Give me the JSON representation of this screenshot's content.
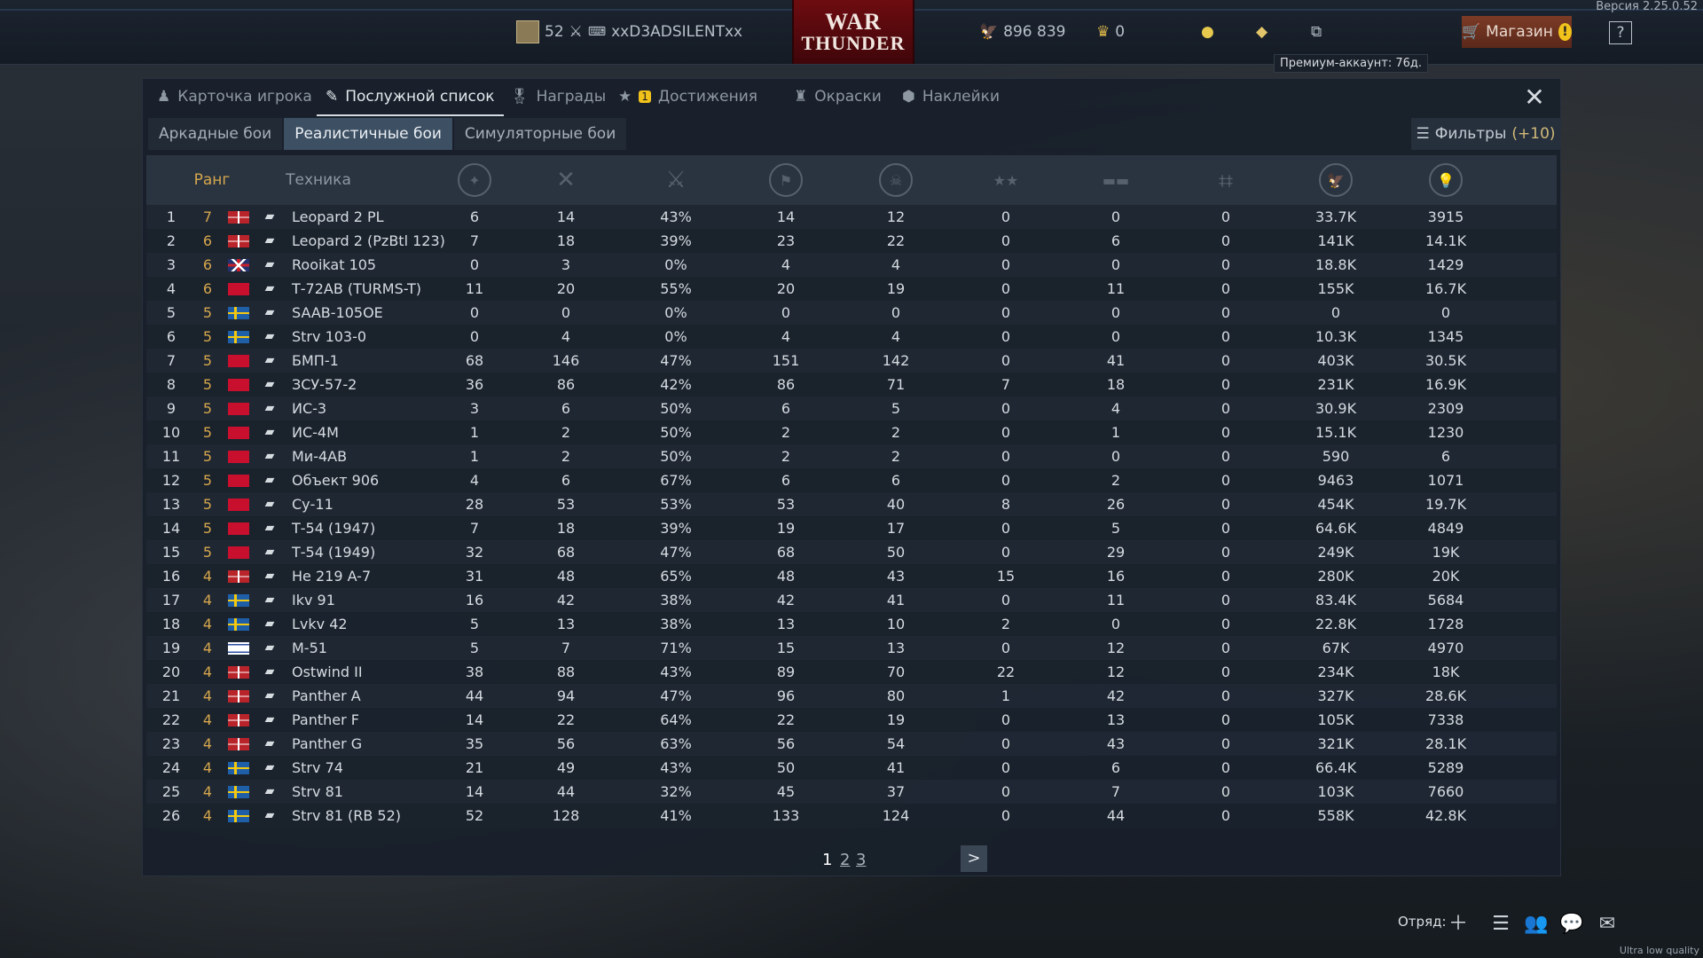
{
  "top": {
    "version": "Версия 2.25.0.52",
    "level": "52",
    "nickname": "xxD3ADSILENTxx",
    "logo_line1": "WAR",
    "logo_line2": "THUNDER",
    "silver": "896 839",
    "gold": "0",
    "shop_label": "Магазин",
    "shop_alert": "!",
    "help": "?",
    "tooltip": "Премиум-аккаунт: 76д."
  },
  "tabs": [
    {
      "label": "Карточка игрока",
      "icon": "player-card-icon"
    },
    {
      "label": "Послужной список",
      "icon": "service-record-icon"
    },
    {
      "label": "Награды",
      "icon": "medal-icon"
    },
    {
      "label": "Достижения",
      "icon": "achievements-icon",
      "badge": "1"
    },
    {
      "label": "Окраски",
      "icon": "paint-icon"
    },
    {
      "label": "Наклейки",
      "icon": "decal-icon"
    }
  ],
  "modes": [
    "Аркадные бои",
    "Реалистичные бои",
    "Симуляторные бои"
  ],
  "filters": {
    "label": "Фильтры",
    "count": "(+10)"
  },
  "table": {
    "headers": {
      "rank": "Ранг",
      "vehicle": "Техника"
    },
    "rows": [
      {
        "n": "1",
        "r": "7",
        "f": "de",
        "name": "Leopard 2 PL",
        "c": [
          "6",
          "14",
          "43%",
          "14",
          "12",
          "0",
          "0",
          "0",
          "33.7K",
          "3915"
        ]
      },
      {
        "n": "2",
        "r": "6",
        "f": "de",
        "name": "Leopard 2 (PzBtl 123)",
        "c": [
          "7",
          "18",
          "39%",
          "23",
          "22",
          "0",
          "6",
          "0",
          "141K",
          "14.1K"
        ]
      },
      {
        "n": "3",
        "r": "6",
        "f": "uk",
        "name": "Rooikat 105",
        "c": [
          "0",
          "3",
          "0%",
          "4",
          "4",
          "0",
          "0",
          "0",
          "18.8K",
          "1429"
        ]
      },
      {
        "n": "4",
        "r": "6",
        "f": "ussr",
        "name": "Т-72АВ (TURMS-T)",
        "c": [
          "11",
          "20",
          "55%",
          "20",
          "19",
          "0",
          "11",
          "0",
          "155K",
          "16.7K"
        ]
      },
      {
        "n": "5",
        "r": "5",
        "f": "se",
        "name": "SAAB-105OE",
        "c": [
          "0",
          "0",
          "0%",
          "0",
          "0",
          "0",
          "0",
          "0",
          "0",
          "0"
        ]
      },
      {
        "n": "6",
        "r": "5",
        "f": "se",
        "name": "Strv 103-0",
        "c": [
          "0",
          "4",
          "0%",
          "4",
          "4",
          "0",
          "0",
          "0",
          "10.3K",
          "1345"
        ]
      },
      {
        "n": "7",
        "r": "5",
        "f": "ussr",
        "name": "БМП-1",
        "c": [
          "68",
          "146",
          "47%",
          "151",
          "142",
          "0",
          "41",
          "0",
          "403K",
          "30.5K"
        ]
      },
      {
        "n": "8",
        "r": "5",
        "f": "ussr",
        "name": "ЗСУ-57-2",
        "c": [
          "36",
          "86",
          "42%",
          "86",
          "71",
          "7",
          "18",
          "0",
          "231K",
          "16.9K"
        ]
      },
      {
        "n": "9",
        "r": "5",
        "f": "ussr",
        "name": "ИС-3",
        "c": [
          "3",
          "6",
          "50%",
          "6",
          "5",
          "0",
          "4",
          "0",
          "30.9K",
          "2309"
        ]
      },
      {
        "n": "10",
        "r": "5",
        "f": "ussr",
        "name": "ИС-4М",
        "c": [
          "1",
          "2",
          "50%",
          "2",
          "2",
          "0",
          "1",
          "0",
          "15.1K",
          "1230"
        ]
      },
      {
        "n": "11",
        "r": "5",
        "f": "ussr",
        "name": "Ми-4АВ",
        "c": [
          "1",
          "2",
          "50%",
          "2",
          "2",
          "0",
          "0",
          "0",
          "590",
          "6"
        ]
      },
      {
        "n": "12",
        "r": "5",
        "f": "ussr",
        "name": "Объект 906",
        "c": [
          "4",
          "6",
          "67%",
          "6",
          "6",
          "0",
          "2",
          "0",
          "9463",
          "1071"
        ]
      },
      {
        "n": "13",
        "r": "5",
        "f": "ussr",
        "name": "Су-11",
        "c": [
          "28",
          "53",
          "53%",
          "53",
          "40",
          "8",
          "26",
          "0",
          "454K",
          "19.7K"
        ]
      },
      {
        "n": "14",
        "r": "5",
        "f": "ussr",
        "name": "Т-54 (1947)",
        "c": [
          "7",
          "18",
          "39%",
          "19",
          "17",
          "0",
          "5",
          "0",
          "64.6K",
          "4849"
        ]
      },
      {
        "n": "15",
        "r": "5",
        "f": "ussr",
        "name": "Т-54 (1949)",
        "c": [
          "32",
          "68",
          "47%",
          "68",
          "50",
          "0",
          "29",
          "0",
          "249K",
          "19K"
        ]
      },
      {
        "n": "16",
        "r": "4",
        "f": "de",
        "name": "He 219 A-7",
        "c": [
          "31",
          "48",
          "65%",
          "48",
          "43",
          "15",
          "16",
          "0",
          "280K",
          "20K"
        ]
      },
      {
        "n": "17",
        "r": "4",
        "f": "se",
        "name": "Ikv 91",
        "c": [
          "16",
          "42",
          "38%",
          "42",
          "41",
          "0",
          "11",
          "0",
          "83.4K",
          "5684"
        ]
      },
      {
        "n": "18",
        "r": "4",
        "f": "se",
        "name": "Lvkv 42",
        "c": [
          "5",
          "13",
          "38%",
          "13",
          "10",
          "2",
          "0",
          "0",
          "22.8K",
          "1728"
        ]
      },
      {
        "n": "19",
        "r": "4",
        "f": "il",
        "name": "M-51",
        "c": [
          "5",
          "7",
          "71%",
          "15",
          "13",
          "0",
          "12",
          "0",
          "67K",
          "4970"
        ]
      },
      {
        "n": "20",
        "r": "4",
        "f": "de",
        "name": "Ostwind II",
        "c": [
          "38",
          "88",
          "43%",
          "89",
          "70",
          "22",
          "12",
          "0",
          "234K",
          "18K"
        ]
      },
      {
        "n": "21",
        "r": "4",
        "f": "de",
        "name": "Panther A",
        "c": [
          "44",
          "94",
          "47%",
          "96",
          "80",
          "1",
          "42",
          "0",
          "327K",
          "28.6K"
        ]
      },
      {
        "n": "22",
        "r": "4",
        "f": "de",
        "name": "Panther F",
        "c": [
          "14",
          "22",
          "64%",
          "22",
          "19",
          "0",
          "13",
          "0",
          "105K",
          "7338"
        ]
      },
      {
        "n": "23",
        "r": "4",
        "f": "de",
        "name": "Panther G",
        "c": [
          "35",
          "56",
          "63%",
          "56",
          "54",
          "0",
          "43",
          "0",
          "321K",
          "28.1K"
        ]
      },
      {
        "n": "24",
        "r": "4",
        "f": "se",
        "name": "Strv 74",
        "c": [
          "21",
          "49",
          "43%",
          "50",
          "41",
          "0",
          "6",
          "0",
          "66.4K",
          "5289"
        ]
      },
      {
        "n": "25",
        "r": "4",
        "f": "se",
        "name": "Strv 81",
        "c": [
          "14",
          "44",
          "32%",
          "45",
          "37",
          "0",
          "7",
          "0",
          "103K",
          "7660"
        ]
      },
      {
        "n": "26",
        "r": "4",
        "f": "se",
        "name": "Strv 81 (RB 52)",
        "c": [
          "52",
          "128",
          "41%",
          "133",
          "124",
          "0",
          "44",
          "0",
          "558K",
          "42.8K"
        ]
      }
    ]
  },
  "pager": {
    "pages": [
      "1",
      "2",
      "3"
    ],
    "next": ">"
  },
  "bottom": {
    "squad_label": "Отряд:",
    "quality": "Ultra low quality"
  }
}
